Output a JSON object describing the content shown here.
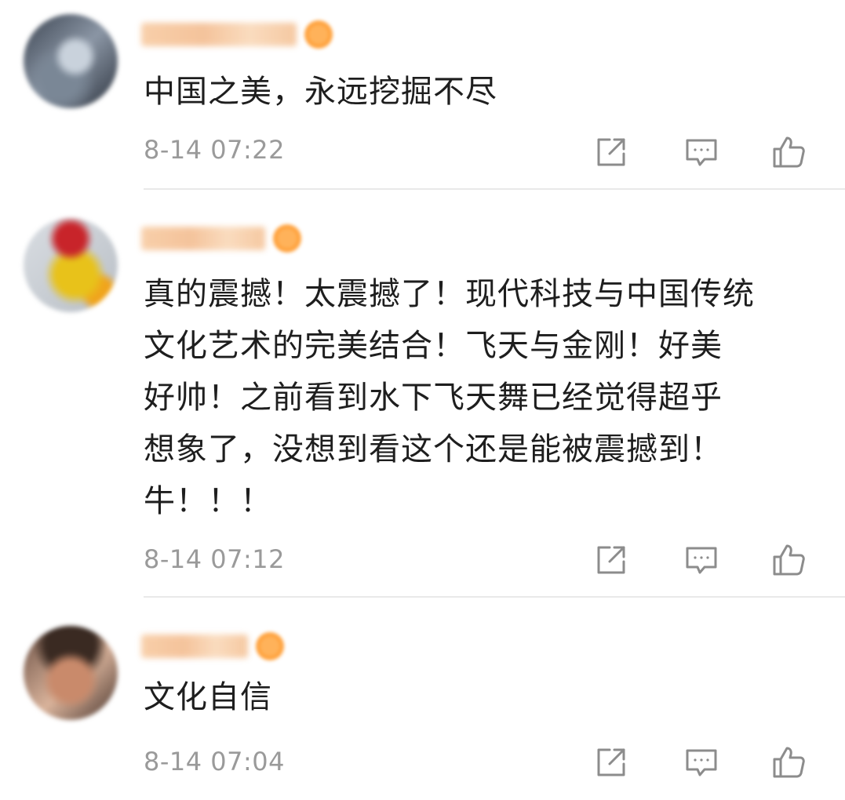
{
  "comments": [
    {
      "text": "中国之美，永远挖掘不尽",
      "time": "8-14 07:22"
    },
    {
      "text": "真的震撼！太震撼了！现代科技与中国传统\n文化艺术的完美结合！飞天与金刚！好美\n好帅！之前看到水下飞天舞已经觉得超乎\n想象了，没想到看这个还是能被震撼到！\n牛！！！",
      "time": "8-14 07:12"
    },
    {
      "text": "文化自信",
      "time": "8-14 07:04"
    }
  ],
  "icons": {
    "share": "share-icon",
    "reply": "comment-icon",
    "like": "thumbs-up-icon"
  },
  "colors": {
    "time": "#9a9a9a",
    "icon": "#8c8c8c",
    "divider": "#e9e9e9",
    "vip_badge": "#ff9a2e"
  }
}
